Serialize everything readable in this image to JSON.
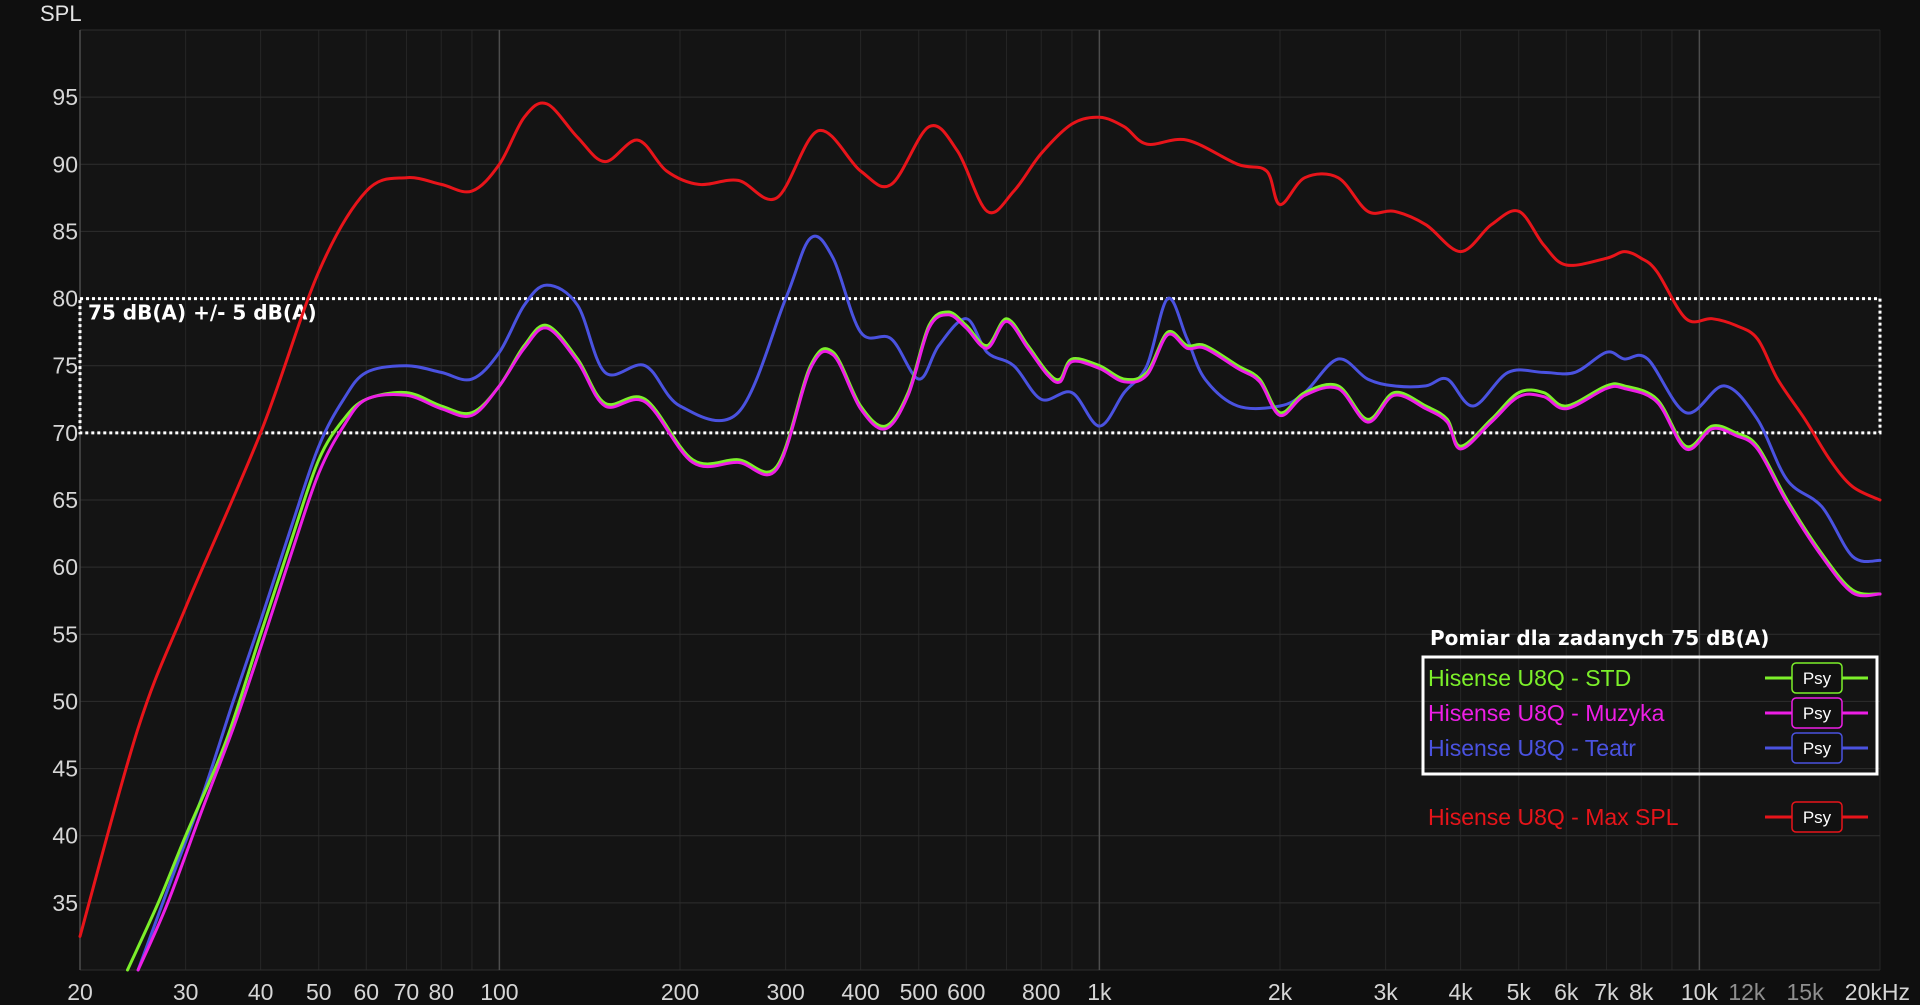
{
  "chart_data": {
    "type": "line",
    "ylabel": "SPL",
    "xlabel": "",
    "x_scale": "log",
    "xlim": [
      20,
      20000
    ],
    "ylim": [
      30,
      100
    ],
    "y_ticks": [
      35,
      40,
      45,
      50,
      55,
      60,
      65,
      70,
      75,
      80,
      85,
      90,
      95
    ],
    "x_ticks": [
      {
        "value": 20,
        "label": "20",
        "major": true
      },
      {
        "value": 30,
        "label": "30",
        "major": false
      },
      {
        "value": 40,
        "label": "40",
        "major": false
      },
      {
        "value": 50,
        "label": "50",
        "major": false
      },
      {
        "value": 60,
        "label": "60",
        "major": false
      },
      {
        "value": 70,
        "label": "70",
        "major": false
      },
      {
        "value": 80,
        "label": "80",
        "major": false
      },
      {
        "value": 100,
        "label": "100",
        "major": true
      },
      {
        "value": 200,
        "label": "200",
        "major": false
      },
      {
        "value": 300,
        "label": "300",
        "major": false
      },
      {
        "value": 400,
        "label": "400",
        "major": false
      },
      {
        "value": 500,
        "label": "500",
        "major": false
      },
      {
        "value": 600,
        "label": "600",
        "major": false
      },
      {
        "value": 800,
        "label": "800",
        "major": false
      },
      {
        "value": 1000,
        "label": "1k",
        "major": true
      },
      {
        "value": 2000,
        "label": "2k",
        "major": false
      },
      {
        "value": 3000,
        "label": "3k",
        "major": false
      },
      {
        "value": 4000,
        "label": "4k",
        "major": false
      },
      {
        "value": 5000,
        "label": "5k",
        "major": false
      },
      {
        "value": 6000,
        "label": "6k",
        "major": false
      },
      {
        "value": 7000,
        "label": "7k",
        "major": false
      },
      {
        "value": 8000,
        "label": "8k",
        "major": false
      },
      {
        "value": 10000,
        "label": "10k",
        "major": true
      },
      {
        "value": 12000,
        "label": "12k",
        "major": false,
        "dim": true
      },
      {
        "value": 15000,
        "label": "15k",
        "major": false,
        "dim": true
      },
      {
        "value": 20000,
        "label": "20kHz",
        "major": false
      }
    ],
    "band": {
      "label": "75 dB(A) +/- 5 dB(A)",
      "y_min": 70,
      "y_max": 80
    },
    "legend": {
      "title": "Pomiar dla zadanych 75 dB(A)",
      "placement": "bottom-right"
    },
    "series": [
      {
        "name": "Hisense U8Q - Max SPL",
        "color": "#e8141a",
        "boxed": false,
        "psy_label": "Psy",
        "points": [
          [
            20,
            32.5
          ],
          [
            25,
            48
          ],
          [
            30,
            57
          ],
          [
            40,
            70
          ],
          [
            50,
            82
          ],
          [
            60,
            88
          ],
          [
            70,
            89
          ],
          [
            80,
            88.5
          ],
          [
            90,
            88
          ],
          [
            100,
            90
          ],
          [
            110,
            93.5
          ],
          [
            120,
            94.5
          ],
          [
            135,
            92
          ],
          [
            150,
            90.2
          ],
          [
            170,
            91.8
          ],
          [
            190,
            89.5
          ],
          [
            215,
            88.5
          ],
          [
            250,
            88.8
          ],
          [
            290,
            87.5
          ],
          [
            340,
            92.5
          ],
          [
            400,
            89.5
          ],
          [
            450,
            88.5
          ],
          [
            520,
            92.8
          ],
          [
            580,
            91
          ],
          [
            650,
            86.5
          ],
          [
            720,
            88
          ],
          [
            800,
            90.8
          ],
          [
            900,
            93
          ],
          [
            1000,
            93.5
          ],
          [
            1100,
            92.8
          ],
          [
            1200,
            91.5
          ],
          [
            1400,
            91.8
          ],
          [
            1700,
            90
          ],
          [
            1900,
            89.5
          ],
          [
            2000,
            87
          ],
          [
            2200,
            89
          ],
          [
            2500,
            89
          ],
          [
            2800,
            86.5
          ],
          [
            3100,
            86.5
          ],
          [
            3500,
            85.5
          ],
          [
            4000,
            83.5
          ],
          [
            4500,
            85.5
          ],
          [
            5000,
            86.5
          ],
          [
            5500,
            84
          ],
          [
            6000,
            82.5
          ],
          [
            7000,
            83
          ],
          [
            7500,
            83.5
          ],
          [
            8000,
            83
          ],
          [
            8500,
            82
          ],
          [
            9500,
            78.5
          ],
          [
            10500,
            78.5
          ],
          [
            11500,
            78
          ],
          [
            12500,
            77
          ],
          [
            13500,
            74
          ],
          [
            15000,
            71
          ],
          [
            16500,
            68
          ],
          [
            18000,
            66
          ],
          [
            20000,
            65
          ]
        ]
      },
      {
        "name": "Hisense U8Q - STD",
        "color": "#7cf02a",
        "boxed": true,
        "psy_label": "Psy",
        "points": [
          [
            24,
            30
          ],
          [
            27,
            35
          ],
          [
            30,
            40
          ],
          [
            35,
            47
          ],
          [
            40,
            55
          ],
          [
            45,
            62
          ],
          [
            50,
            68
          ],
          [
            55,
            71
          ],
          [
            60,
            72.5
          ],
          [
            70,
            73
          ],
          [
            80,
            72
          ],
          [
            90,
            71.5
          ],
          [
            100,
            73.5
          ],
          [
            110,
            76.5
          ],
          [
            120,
            78
          ],
          [
            135,
            75.5
          ],
          [
            150,
            72.2
          ],
          [
            175,
            72.5
          ],
          [
            210,
            68
          ],
          [
            250,
            68
          ],
          [
            290,
            67.5
          ],
          [
            330,
            75
          ],
          [
            360,
            76
          ],
          [
            400,
            72
          ],
          [
            440,
            70.5
          ],
          [
            480,
            73
          ],
          [
            520,
            78
          ],
          [
            560,
            79
          ],
          [
            600,
            78
          ],
          [
            650,
            76.5
          ],
          [
            700,
            78.5
          ],
          [
            760,
            76.5
          ],
          [
            820,
            74.5
          ],
          [
            860,
            74
          ],
          [
            900,
            75.5
          ],
          [
            1000,
            75
          ],
          [
            1100,
            74
          ],
          [
            1200,
            74.5
          ],
          [
            1300,
            77.5
          ],
          [
            1400,
            76.5
          ],
          [
            1500,
            76.5
          ],
          [
            1700,
            75
          ],
          [
            1850,
            74
          ],
          [
            2000,
            71.5
          ],
          [
            2200,
            73
          ],
          [
            2500,
            73.5
          ],
          [
            2800,
            71
          ],
          [
            3100,
            73
          ],
          [
            3500,
            72
          ],
          [
            3800,
            71
          ],
          [
            4000,
            69
          ],
          [
            4500,
            71
          ],
          [
            5000,
            73
          ],
          [
            5500,
            73
          ],
          [
            6000,
            72
          ],
          [
            7000,
            73.5
          ],
          [
            7500,
            73.5
          ],
          [
            8500,
            72.5
          ],
          [
            9500,
            69
          ],
          [
            10500,
            70.5
          ],
          [
            11500,
            70
          ],
          [
            12500,
            69
          ],
          [
            14000,
            65
          ],
          [
            16000,
            61
          ],
          [
            18000,
            58.3
          ],
          [
            20000,
            58
          ]
        ]
      },
      {
        "name": "Hisense U8Q - Muzyka",
        "color": "#ee1ee6",
        "boxed": true,
        "psy_label": "Psy",
        "points": [
          [
            25,
            30
          ],
          [
            28,
            35
          ],
          [
            32,
            42
          ],
          [
            36,
            48
          ],
          [
            40,
            54
          ],
          [
            45,
            61
          ],
          [
            50,
            67
          ],
          [
            55,
            70.5
          ],
          [
            60,
            72.5
          ],
          [
            70,
            72.8
          ],
          [
            80,
            71.8
          ],
          [
            90,
            71.3
          ],
          [
            100,
            73.5
          ],
          [
            110,
            76.3
          ],
          [
            120,
            77.8
          ],
          [
            135,
            75.3
          ],
          [
            150,
            72
          ],
          [
            175,
            72.3
          ],
          [
            210,
            67.8
          ],
          [
            250,
            67.8
          ],
          [
            290,
            67.3
          ],
          [
            330,
            74.8
          ],
          [
            360,
            75.8
          ],
          [
            400,
            71.8
          ],
          [
            440,
            70.3
          ],
          [
            480,
            72.8
          ],
          [
            520,
            77.8
          ],
          [
            560,
            78.8
          ],
          [
            600,
            77.8
          ],
          [
            650,
            76.3
          ],
          [
            700,
            78.3
          ],
          [
            760,
            76.3
          ],
          [
            820,
            74.3
          ],
          [
            860,
            73.8
          ],
          [
            900,
            75.3
          ],
          [
            1000,
            74.8
          ],
          [
            1100,
            73.8
          ],
          [
            1200,
            74.3
          ],
          [
            1300,
            77.3
          ],
          [
            1400,
            76.3
          ],
          [
            1500,
            76.3
          ],
          [
            1700,
            74.8
          ],
          [
            1850,
            73.8
          ],
          [
            2000,
            71.3
          ],
          [
            2200,
            72.8
          ],
          [
            2500,
            73.3
          ],
          [
            2800,
            70.8
          ],
          [
            3100,
            72.8
          ],
          [
            3500,
            71.8
          ],
          [
            3800,
            70.8
          ],
          [
            4000,
            68.8
          ],
          [
            4500,
            70.8
          ],
          [
            5000,
            72.7
          ],
          [
            5500,
            72.7
          ],
          [
            6000,
            71.8
          ],
          [
            7000,
            73.3
          ],
          [
            7500,
            73.3
          ],
          [
            8500,
            72.3
          ],
          [
            9500,
            68.8
          ],
          [
            10500,
            70.3
          ],
          [
            11500,
            69.8
          ],
          [
            12500,
            68.8
          ],
          [
            14000,
            64.8
          ],
          [
            16000,
            60.8
          ],
          [
            18000,
            58.1
          ],
          [
            20000,
            58
          ]
        ]
      },
      {
        "name": "Hisense U8Q - Teatr",
        "color": "#4a52e0",
        "boxed": true,
        "psy_label": "Psy",
        "points": [
          [
            25,
            30
          ],
          [
            28,
            36
          ],
          [
            32,
            43
          ],
          [
            36,
            50
          ],
          [
            40,
            56
          ],
          [
            45,
            63
          ],
          [
            50,
            69
          ],
          [
            55,
            72.5
          ],
          [
            60,
            74.5
          ],
          [
            70,
            75
          ],
          [
            80,
            74.5
          ],
          [
            90,
            74
          ],
          [
            100,
            76
          ],
          [
            110,
            79.5
          ],
          [
            120,
            81
          ],
          [
            135,
            79.5
          ],
          [
            150,
            74.5
          ],
          [
            175,
            75
          ],
          [
            200,
            72
          ],
          [
            250,
            71.5
          ],
          [
            300,
            80
          ],
          [
            330,
            84.5
          ],
          [
            360,
            83
          ],
          [
            400,
            77.5
          ],
          [
            450,
            77
          ],
          [
            500,
            74
          ],
          [
            540,
            76.5
          ],
          [
            600,
            78.5
          ],
          [
            650,
            76
          ],
          [
            720,
            75
          ],
          [
            800,
            72.5
          ],
          [
            900,
            73
          ],
          [
            1000,
            70.5
          ],
          [
            1100,
            73
          ],
          [
            1200,
            75
          ],
          [
            1300,
            80
          ],
          [
            1400,
            77
          ],
          [
            1500,
            74
          ],
          [
            1700,
            72
          ],
          [
            2000,
            72
          ],
          [
            2200,
            73
          ],
          [
            2500,
            75.5
          ],
          [
            2800,
            74
          ],
          [
            3100,
            73.5
          ],
          [
            3500,
            73.5
          ],
          [
            3800,
            74
          ],
          [
            4200,
            72
          ],
          [
            4800,
            74.5
          ],
          [
            5500,
            74.5
          ],
          [
            6200,
            74.5
          ],
          [
            7000,
            76
          ],
          [
            7500,
            75.5
          ],
          [
            8200,
            75.5
          ],
          [
            9500,
            71.5
          ],
          [
            11000,
            73.5
          ],
          [
            12500,
            71
          ],
          [
            14000,
            66.5
          ],
          [
            16000,
            64.5
          ],
          [
            18000,
            60.8
          ],
          [
            20000,
            60.5
          ]
        ]
      }
    ]
  }
}
